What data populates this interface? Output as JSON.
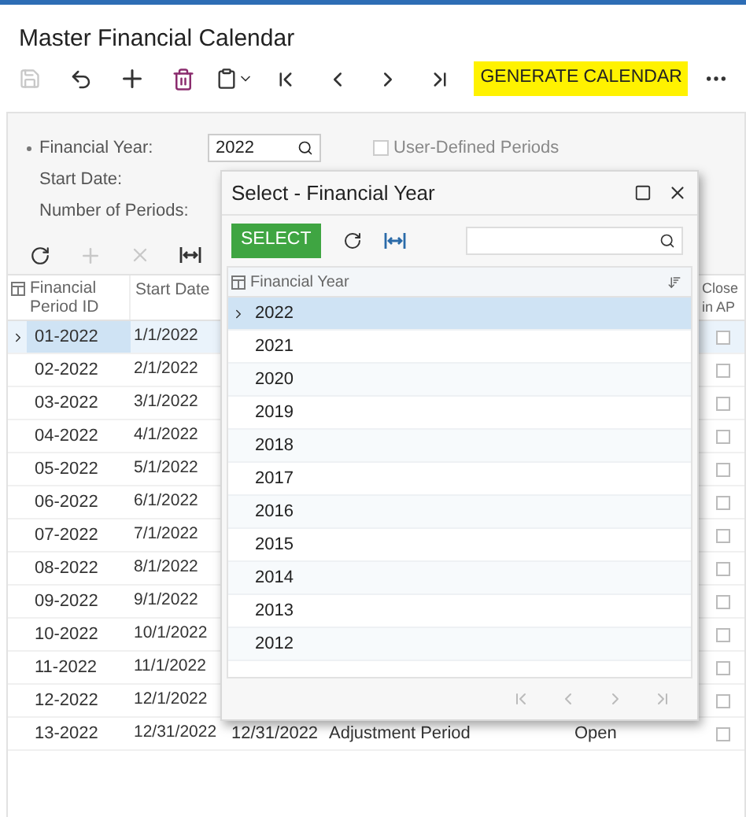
{
  "page": {
    "title": "Master Financial Calendar"
  },
  "toolbar": {
    "generate_button": "GENERATE CALENDAR"
  },
  "form": {
    "financial_year_label": "Financial Year:",
    "financial_year": "2022",
    "user_defined_label": "User-Defined Periods",
    "user_defined_checked": false,
    "start_date_label": "Start Date:",
    "periods_label": "Number of Periods:"
  },
  "grid": {
    "columns": [
      "Financial Period ID",
      "Start Date",
      "Close in AP"
    ],
    "rows": [
      {
        "period_id": "01-2022",
        "start_date": "1/1/2022",
        "selected": true,
        "closed_in_ap": false
      },
      {
        "period_id": "02-2022",
        "start_date": "2/1/2022",
        "selected": false,
        "closed_in_ap": false
      },
      {
        "period_id": "03-2022",
        "start_date": "3/1/2022",
        "selected": false,
        "closed_in_ap": false
      },
      {
        "period_id": "04-2022",
        "start_date": "4/1/2022",
        "selected": false,
        "closed_in_ap": false
      },
      {
        "period_id": "05-2022",
        "start_date": "5/1/2022",
        "selected": false,
        "closed_in_ap": false
      },
      {
        "period_id": "06-2022",
        "start_date": "6/1/2022",
        "selected": false,
        "closed_in_ap": false
      },
      {
        "period_id": "07-2022",
        "start_date": "7/1/2022",
        "selected": false,
        "closed_in_ap": false
      },
      {
        "period_id": "08-2022",
        "start_date": "8/1/2022",
        "selected": false,
        "closed_in_ap": false
      },
      {
        "period_id": "09-2022",
        "start_date": "9/1/2022",
        "selected": false,
        "closed_in_ap": false
      },
      {
        "period_id": "10-2022",
        "start_date": "10/1/2022",
        "selected": false,
        "closed_in_ap": false
      },
      {
        "period_id": "11-2022",
        "start_date": "11/1/2022",
        "selected": false,
        "closed_in_ap": false
      },
      {
        "period_id": "12-2022",
        "start_date": "12/1/2022",
        "selected": false,
        "closed_in_ap": false
      },
      {
        "period_id": "13-2022",
        "start_date": "12/31/2022",
        "end_date": "12/31/2022",
        "description": "Adjustment Period",
        "status": "Open",
        "selected": false,
        "closed_in_ap": false
      }
    ]
  },
  "dialog": {
    "title": "Select - Financial Year",
    "select_button": "SELECT",
    "column": "Financial Year",
    "rows": [
      {
        "year": "2022",
        "selected": true
      },
      {
        "year": "2021",
        "selected": false
      },
      {
        "year": "2020",
        "selected": false
      },
      {
        "year": "2019",
        "selected": false
      },
      {
        "year": "2018",
        "selected": false
      },
      {
        "year": "2017",
        "selected": false
      },
      {
        "year": "2016",
        "selected": false
      },
      {
        "year": "2015",
        "selected": false
      },
      {
        "year": "2014",
        "selected": false
      },
      {
        "year": "2013",
        "selected": false
      },
      {
        "year": "2012",
        "selected": false
      }
    ]
  }
}
